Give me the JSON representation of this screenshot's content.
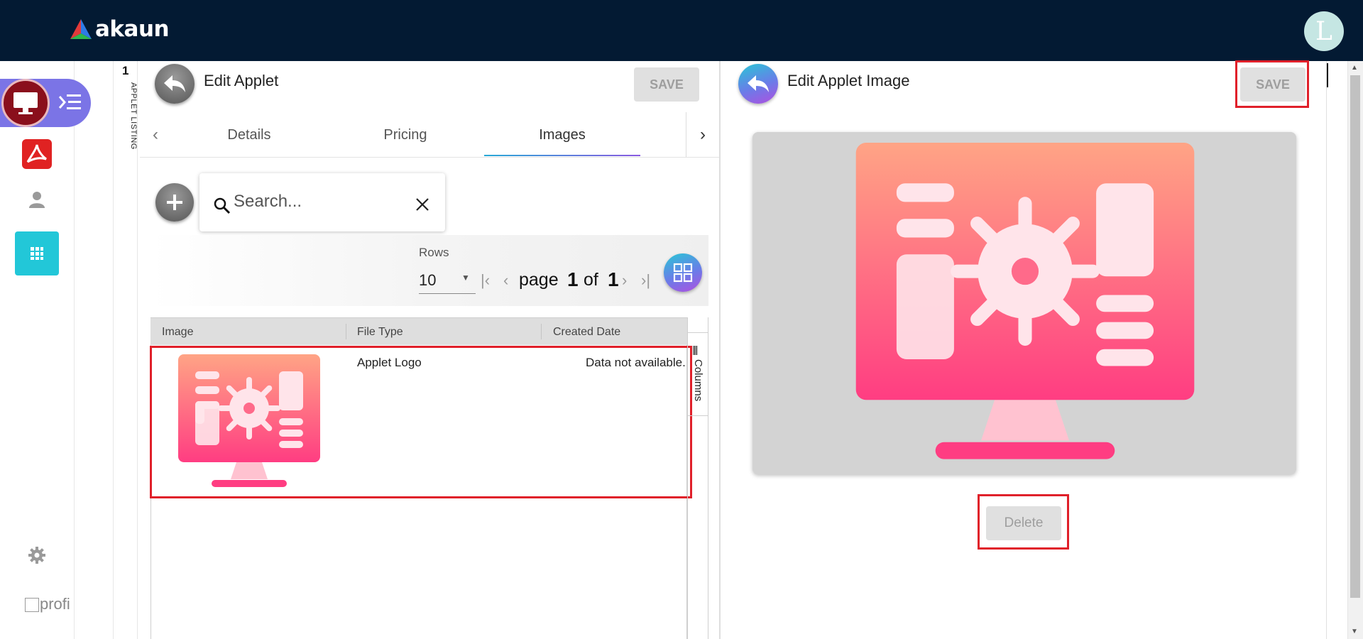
{
  "app": {
    "brand": "akaun",
    "avatar_initial": "L"
  },
  "colors": {
    "topbar": "#031a33",
    "accent_purple": "#7b74e6",
    "accent_cyan": "#22c7d8",
    "highlight_red": "#e0202a",
    "card_bg": "#d3d3d3"
  },
  "sidebar": {
    "items": [
      {
        "icon": "monitor-icon",
        "active": true
      },
      {
        "icon": "acrobat-icon"
      },
      {
        "icon": "person-icon"
      },
      {
        "icon": "apps-grid-icon"
      },
      {
        "icon": "gear-icon"
      }
    ],
    "profile_label": "profi"
  },
  "vertical_tab": {
    "number": "1",
    "label": "APPLET LISTING"
  },
  "edit_applet": {
    "title": "Edit Applet",
    "save_label": "SAVE",
    "tabs": [
      {
        "label": "Details",
        "selected": false
      },
      {
        "label": "Pricing",
        "selected": false
      },
      {
        "label": "Images",
        "selected": true
      }
    ],
    "search": {
      "placeholder": "Search..."
    },
    "pagination": {
      "rows_label": "Rows",
      "rows_value": "10",
      "page_word": "page",
      "page": "1",
      "of_word": "of",
      "total": "1"
    },
    "grid": {
      "columns": [
        "Image",
        "File Type",
        "Created Date"
      ],
      "rows": [
        {
          "file_type": "Applet Logo",
          "created_date": "Data not available."
        }
      ],
      "side_panel_label": "Columns"
    }
  },
  "edit_image": {
    "title": "Edit Applet Image",
    "save_label": "SAVE",
    "delete_label": "Delete"
  }
}
